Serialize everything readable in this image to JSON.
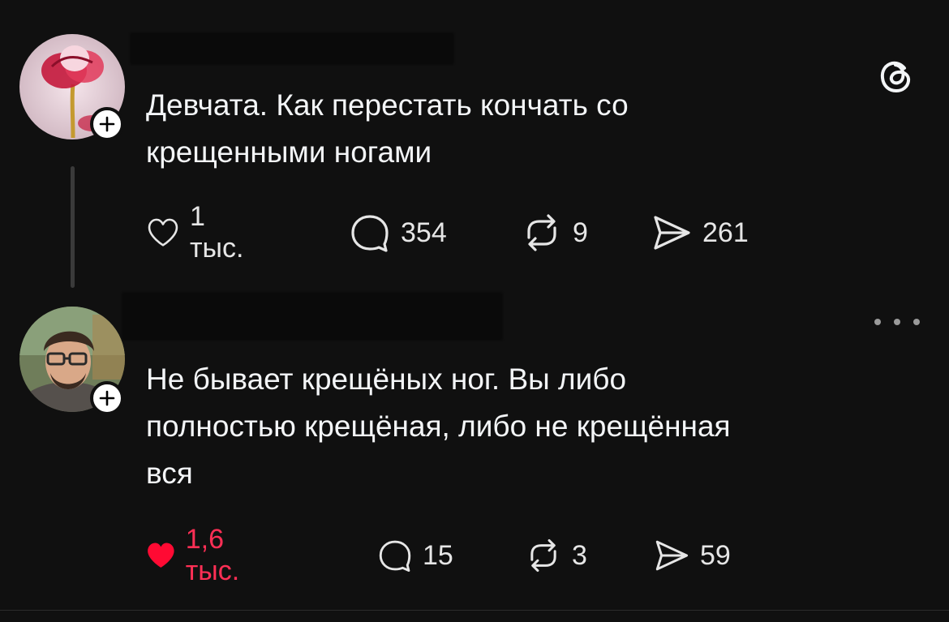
{
  "app": {
    "logo_icon": "threads-logo-icon"
  },
  "posts": [
    {
      "text": "Девчата. Как перестать кончать со\nкрещенными ногами",
      "actions": {
        "like": {
          "icon": "heart-icon",
          "count": "1 тыс.",
          "liked": false
        },
        "reply": {
          "icon": "comment-icon",
          "count": "354"
        },
        "repost": {
          "icon": "repost-icon",
          "count": "9"
        },
        "share": {
          "icon": "send-icon",
          "count": "261"
        }
      }
    },
    {
      "text": "Не бывает крещёных ног. Вы либо\nполностью крещёная, либо не крещённая\nвся",
      "actions": {
        "like": {
          "icon": "heart-filled-icon",
          "count": "1,6 тыс.",
          "liked": true
        },
        "reply": {
          "icon": "comment-icon",
          "count": "15"
        },
        "repost": {
          "icon": "repost-icon",
          "count": "3"
        },
        "share": {
          "icon": "send-icon",
          "count": "59"
        }
      }
    }
  ],
  "colors": {
    "background": "#101010",
    "text": "#f3f5f7",
    "like_active": "#ff2f55"
  }
}
